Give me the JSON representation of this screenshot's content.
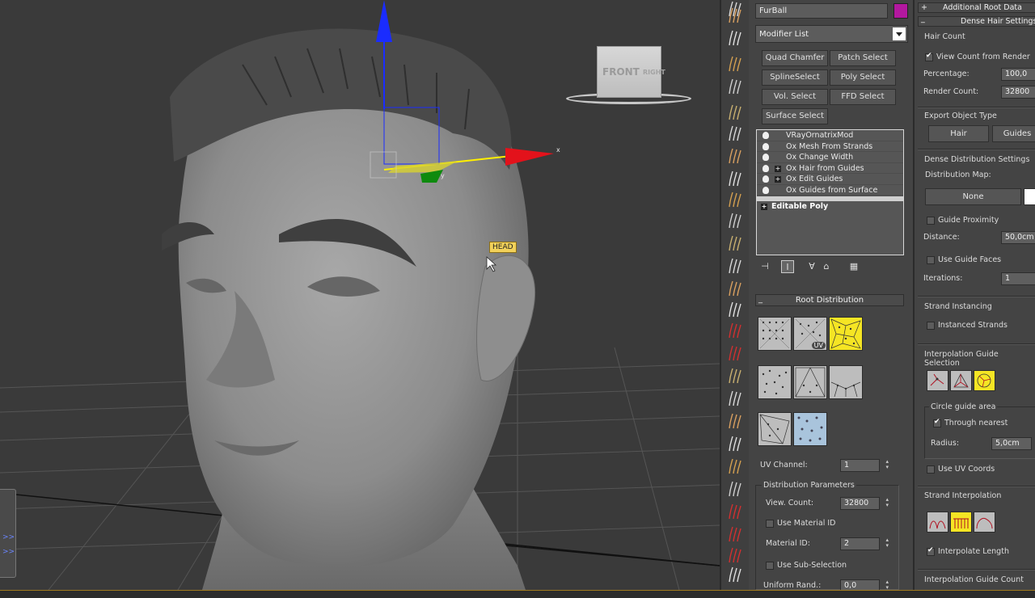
{
  "viewport": {
    "object_label": "HEAD",
    "viewcube": {
      "front": "FRONT",
      "right": "RIGHT"
    },
    "gizmo": {
      "x": "x",
      "y": "y"
    },
    "nav_widget_glyphs": [
      ">>",
      ">>"
    ]
  },
  "modifier_panel": {
    "object_name": "FurBall",
    "object_color": "#b3189f",
    "modifier_list": "Modifier List",
    "buttons": [
      "Quad Chamfer",
      "Patch Select",
      "SplineSelect",
      "Poly Select",
      "Vol. Select",
      "FFD Select",
      "Surface Select"
    ],
    "stack": [
      "VRayOrnatrixMod",
      "Ox Mesh From Strands",
      "Ox Change Width",
      "Ox Hair from Guides",
      "Ox Edit Guides",
      "Ox Guides from Surface"
    ],
    "stack_base": "Editable Poly",
    "root_distribution": {
      "title": "Root Distribution",
      "toggle": "_",
      "uv_badge": "UV",
      "uv_channel_label": "UV Channel:",
      "uv_channel": "1",
      "params_title": "Distribution Parameters",
      "view_count_label": "View. Count:",
      "view_count": "32800",
      "use_material_id": "Use Material ID",
      "material_id_label": "Material ID:",
      "material_id": "2",
      "use_sub_selection": "Use Sub-Selection",
      "uniform_rand_label": "Uniform Rand.:",
      "uniform_rand": "0,0"
    }
  },
  "right_panel": {
    "additional_root_data": "Additional Root Data",
    "dense_hair_settings": "Dense Hair Settings",
    "plus": "+",
    "minus": "_",
    "hair_count": "Hair Count",
    "view_count_from_render": "View Count from Render",
    "percentage_label": "Percentage:",
    "percentage": "100,0",
    "render_count_label": "Render Count:",
    "render_count": "32800",
    "export_object_type": "Export Object Type",
    "hair_btn": "Hair",
    "guides_btn": "Guides",
    "dense_distribution_settings": "Dense Distribution Settings",
    "distribution_map": "Distribution Map:",
    "none_btn": "None",
    "guide_proximity": "Guide Proximity",
    "distance_label": "Distance:",
    "distance": "50,0cm",
    "use_guide_faces": "Use Guide Faces",
    "iterations_label": "Iterations:",
    "iterations": "1",
    "strand_instancing": "Strand Instancing",
    "instanced_strands": "Instanced Strands",
    "interp_guide_selection": "Interpolation Guide Selection",
    "circle_guide_area": "Circle guide area",
    "through_nearest": "Through nearest",
    "radius_label": "Radius:",
    "radius": "5,0cm",
    "use_uv_coords": "Use UV Coords",
    "strand_interpolation": "Strand Interpolation",
    "interpolate_length": "Interpolate Length",
    "interp_guide_count": "Interpolation Guide Count"
  }
}
